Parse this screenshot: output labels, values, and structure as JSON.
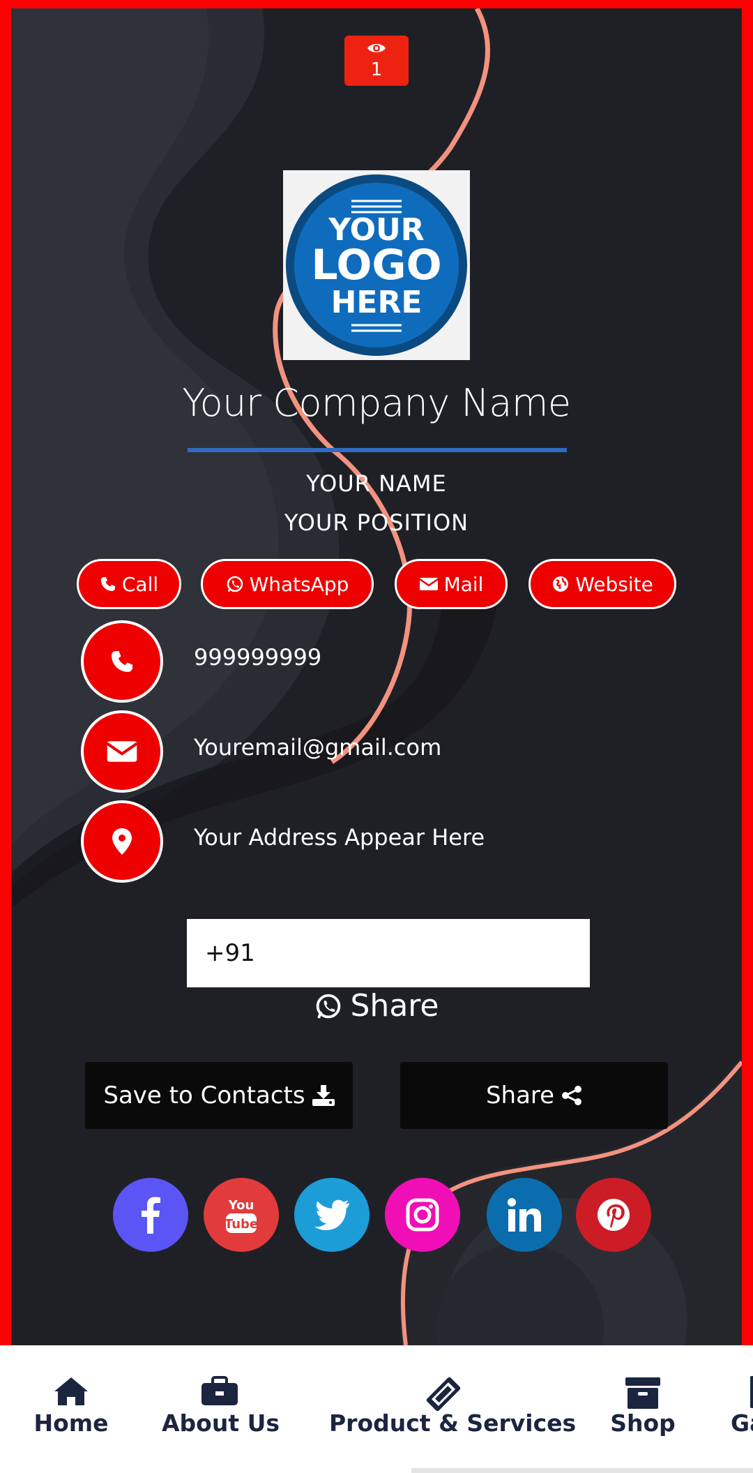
{
  "views": {
    "count": "1",
    "icon": "eye-icon"
  },
  "logo": {
    "line1": "YOUR",
    "line2": "LOGO",
    "line3": "HERE"
  },
  "company_name": "Your Company Name",
  "person": {
    "name": "YOUR NAME",
    "position": "YOUR POSITION"
  },
  "quick_actions": [
    {
      "label": "Call",
      "icon": "phone-icon"
    },
    {
      "label": "WhatsApp",
      "icon": "whatsapp-icon"
    },
    {
      "label": "Mail",
      "icon": "envelope-icon"
    },
    {
      "label": "Website",
      "icon": "globe-icon"
    }
  ],
  "contact": {
    "phone": "999999999",
    "email": "Youremail@gmail.com",
    "address": "Your Address Appear Here"
  },
  "share_form": {
    "phone_value": "+91",
    "share_label": "Share"
  },
  "buttons": {
    "save_contacts": "Save to Contacts",
    "share": "Share"
  },
  "social": [
    {
      "name": "facebook",
      "color": "#5b55f5"
    },
    {
      "name": "youtube",
      "color": "#e13b3b"
    },
    {
      "name": "twitter",
      "color": "#1d9dd8"
    },
    {
      "name": "instagram",
      "color": "#f00fb6"
    },
    {
      "name": "linkedin",
      "color": "#0b6dad"
    },
    {
      "name": "pinterest",
      "color": "#cc1c26"
    }
  ],
  "colors": {
    "accent_red": "#ee0000",
    "border_red": "#ff0000",
    "divider_blue": "#2f6bc4",
    "nav_text": "#1b2540"
  },
  "nav": [
    {
      "label": "Home",
      "icon": "home-icon"
    },
    {
      "label": "About Us",
      "icon": "briefcase-icon"
    },
    {
      "label": "Product & Services",
      "icon": "ticket-icon"
    },
    {
      "label": "Shop",
      "icon": "archive-box-icon"
    },
    {
      "label": "Ga",
      "icon": "gallery-icon"
    }
  ]
}
